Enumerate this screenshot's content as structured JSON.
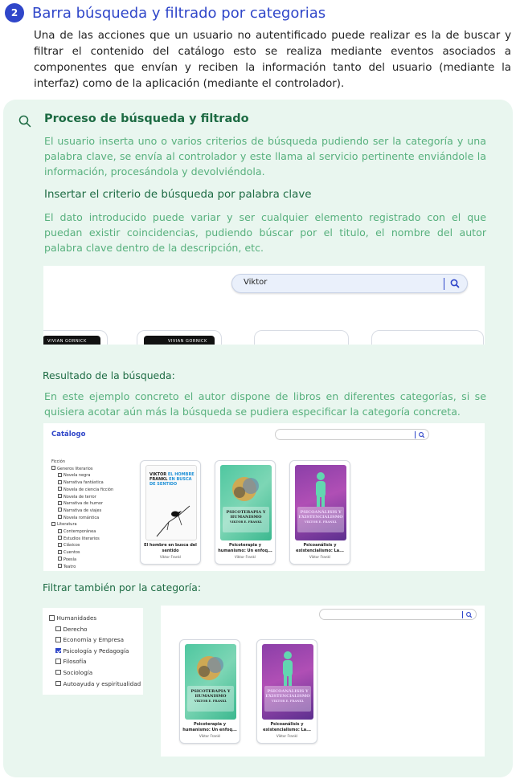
{
  "section": {
    "number": "2",
    "title": "Barra búsqueda y filtrado por categorias",
    "intro": "Una de las acciones que un usuario no autentificado puede realizar es la de buscar y filtrar el contenido del catálogo esto se realiza mediante eventos asociados a componentes que envían y reciben la información tanto del usuario (mediante la interfaz) como de la aplicación (mediante el controlador)."
  },
  "panel": {
    "icon": "search-icon",
    "title": "Proceso de búsqueda y filtrado",
    "text": "El usuario inserta uno o varios criterios de búsqueda pudiendo ser la categoría y una palabra clave, se envía al controlador y este llama al servicio pertinente enviándole la información, procesándola y devolviéndola.",
    "subtitle": "Insertar el criterio de búsqueda por palabra clave",
    "subtext": "El dato introducido puede variar y ser cualquier elemento registrado con el que puedan existir coincidencias, pudiendo búscar por el titulo, el nombre del autor palabra clave dentro de la descripción, etc.",
    "result_label": "Resultado de la búsqueda:",
    "result_text": "En este ejemplo concreto el autor dispone de libros en diferentes categorías, si se quisiera acotar aún más la búsqueda se pudiera especificar la categoría concreta.",
    "filter_label": "Filtrar también por la categoría:"
  },
  "shot1": {
    "search_value": "Viktor",
    "card_text": "VIVIAN GORNICK"
  },
  "shot2": {
    "catalog_title": "Catálogo",
    "tree_header": "Ficción",
    "tree": [
      {
        "label": "Generos literarios",
        "level": 0
      },
      {
        "label": "Novela negra",
        "level": 1
      },
      {
        "label": "Narrativa fantástica",
        "level": 1
      },
      {
        "label": "Novela de ciencia ficción",
        "level": 1
      },
      {
        "label": "Novela de terror",
        "level": 1
      },
      {
        "label": "Narrativa de humor",
        "level": 1
      },
      {
        "label": "Narrativa de viajes",
        "level": 1
      },
      {
        "label": "Novela romántica",
        "level": 1
      },
      {
        "label": "Literatura",
        "level": 0
      },
      {
        "label": "Contemporánea",
        "level": 1
      },
      {
        "label": "Estudios literarios",
        "level": 1
      },
      {
        "label": "Clásicos",
        "level": 1
      },
      {
        "label": "Cuentos",
        "level": 1
      },
      {
        "label": "Poesía",
        "level": 1
      },
      {
        "label": "Teatro",
        "level": 1
      }
    ],
    "books": [
      {
        "title": "El hombre en busca del sentido",
        "author": "Viktor Frankl",
        "cover_line1": "VIKTOR",
        "cover_line1b": "EL HOMBRE",
        "cover_line2": "FRANKL",
        "cover_line2b": "EN BUSCA",
        "cover_line3b": "DE SENTIDO"
      },
      {
        "title": "Psicoterapia y humanismo: Un enfoq...",
        "author": "Viktor Frankl",
        "cover_title": "PSICOTERAPIA Y HUMANISMO",
        "cover_author": "VIKTOR E. FRANKL"
      },
      {
        "title": "Psicoanálisis y existencialismo: La...",
        "author": "Viktor Frankl",
        "cover_title": "PSICOANÁLISIS Y EXISTENCIALISMO",
        "cover_author": "VIKTOR E. FRANKL"
      }
    ]
  },
  "shot3": {
    "tree": [
      {
        "label": "Humanidades",
        "level": 0,
        "checked": false
      },
      {
        "label": "Derecho",
        "level": 1,
        "checked": false
      },
      {
        "label": "Economía y Empresa",
        "level": 1,
        "checked": false
      },
      {
        "label": "Psicología y Pedagogía",
        "level": 1,
        "checked": true
      },
      {
        "label": "Filosofía",
        "level": 1,
        "checked": false
      },
      {
        "label": "Sociología",
        "level": 1,
        "checked": false
      },
      {
        "label": "Autoayuda y espiritualidad",
        "level": 1,
        "checked": false
      }
    ],
    "books": [
      {
        "title": "Psicoterapia y humanismo: Un enfoq...",
        "author": "Viktor Frankl",
        "cover_title": "PSICOTERAPIA Y HUMANISMO",
        "cover_author": "VIKTOR E. FRANKL"
      },
      {
        "title": "Psicoanálisis y existencialismo: La...",
        "author": "Viktor Frankl",
        "cover_title": "PSICOANÁLISIS Y EXISTENCIALISMO",
        "cover_author": "VIKTOR E. FRANKL"
      }
    ]
  },
  "colors": {
    "accent": "#2f46c9",
    "panel_bg": "#e9f6ef",
    "panel_title": "#1d6b43",
    "panel_text": "#57b07d"
  }
}
